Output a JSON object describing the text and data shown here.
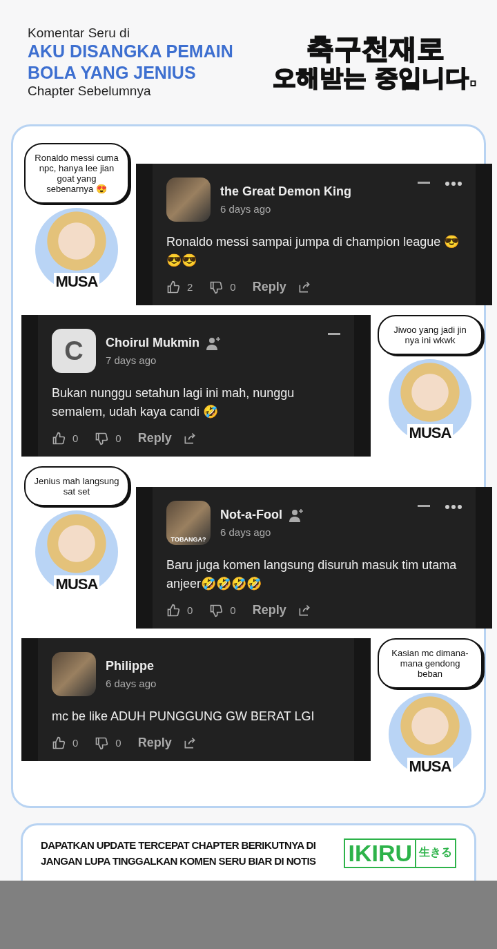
{
  "header": {
    "intro": "Komentar Seru di",
    "title_lines": [
      "AKU DISANGKA PEMAIN",
      "BOLA YANG JENIUS"
    ],
    "subtitle": "Chapter Sebelumnya",
    "korean_title_lines": [
      "축구천재로",
      "오해받는 중입니다."
    ]
  },
  "comments": [
    {
      "kind": "left",
      "bubble": "Ronaldo messi cuma npc, hanya lee jian goat yang sebenarnya 😍",
      "character_label": "MUSA",
      "avatar": {
        "kind": "image"
      },
      "author": "the Great Demon King",
      "follow_icon": false,
      "collapse_icon": true,
      "more_icon": true,
      "time": "6 days ago",
      "text": "Ronaldo messi sampai jumpa di champion league 😎😎😎",
      "likes": "2",
      "dislikes": "0",
      "reply": "Reply"
    },
    {
      "kind": "right",
      "bubble": "Jiwoo yang jadi jin nya ini wkwk",
      "character_label": "MUSA",
      "avatar": {
        "kind": "letter",
        "letter": "C"
      },
      "author": "Choirul Mukmin",
      "follow_icon": true,
      "collapse_icon": true,
      "more_icon": false,
      "time": "7 days ago",
      "text": "Bukan nunggu setahun lagi ini mah, nunggu semalem, udah kaya candi 🤣",
      "likes": "0",
      "dislikes": "0",
      "reply": "Reply"
    },
    {
      "kind": "left",
      "bubble": "Jenius mah langsung sat set",
      "character_label": "MUSA",
      "avatar": {
        "kind": "image",
        "caption": "TOBANGA?"
      },
      "author": "Not-a-Fool",
      "follow_icon": true,
      "collapse_icon": true,
      "more_icon": true,
      "time": "6 days ago",
      "text": "Baru juga komen langsung disuruh masuk tim utama anjeer🤣🤣🤣🤣",
      "likes": "0",
      "dislikes": "0",
      "reply": "Reply"
    },
    {
      "kind": "right",
      "bubble": "Kasian mc dimana-mana gendong beban",
      "character_label": "MUSA",
      "avatar": {
        "kind": "image"
      },
      "author": "Philippe",
      "follow_icon": false,
      "collapse_icon": false,
      "more_icon": false,
      "time": "6 days ago",
      "text": "mc be like ADUH PUNGGUNG GW BERAT LGI",
      "likes": "0",
      "dislikes": "0",
      "reply": "Reply"
    }
  ],
  "footer": {
    "lines": [
      "DAPATKAN UPDATE TERCEPAT CHAPTER BERIKUTNYA DI",
      "JANGAN LUPA TINGGALKAN KOMEN SERU BIAR DI NOTIS"
    ],
    "logo_text": "IKIRU",
    "logo_kana": "生きる"
  }
}
